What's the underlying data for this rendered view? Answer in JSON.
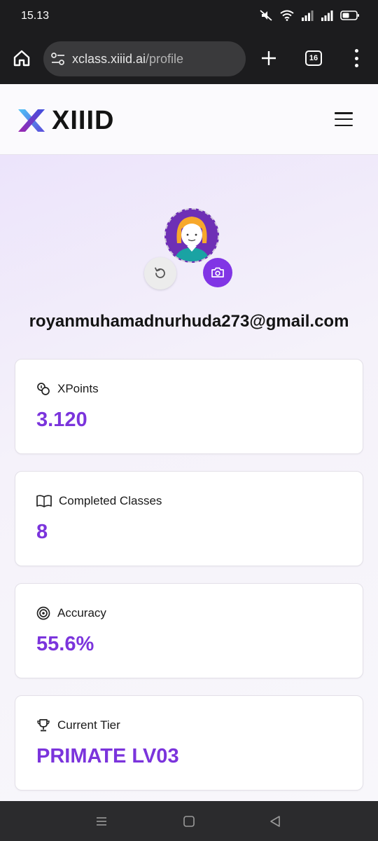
{
  "status_bar": {
    "time": "15.13",
    "icons": [
      "mute-icon",
      "wifi-icon",
      "signal-icon",
      "signal-icon",
      "battery-icon"
    ]
  },
  "browser": {
    "url_host": "xclass.xiiid.ai",
    "url_path": "/profile",
    "tab_count": "16"
  },
  "header": {
    "logo_text": "XIIID"
  },
  "profile": {
    "email": "royanmuhamadnurhuda273@gmail.com"
  },
  "stats": [
    {
      "label": "XPoints",
      "value": "3.120",
      "icon": "coins-icon"
    },
    {
      "label": "Completed Classes",
      "value": "8",
      "icon": "book-icon"
    },
    {
      "label": "Accuracy",
      "value": "55.6%",
      "icon": "target-icon"
    },
    {
      "label": "Current Tier",
      "value": "PRIMATE LV03",
      "icon": "trophy-icon"
    }
  ],
  "colors": {
    "accent": "#7b34dc",
    "camera_button": "#8135e5",
    "avatar_bg": "#6e2fb5"
  }
}
